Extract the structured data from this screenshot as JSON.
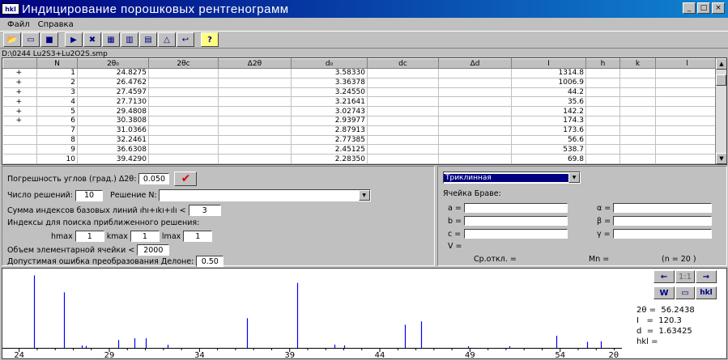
{
  "window": {
    "icon_text": "hkl",
    "title": "Индицирование порошковых рентгенограмм",
    "min": "_",
    "max": "□",
    "close": "×"
  },
  "menu": [
    "Файл",
    "Справка"
  ],
  "toolbar": [
    {
      "icon": "open-folder-icon",
      "glyph": "📂"
    },
    {
      "icon": "save-icon",
      "glyph": "▭"
    },
    {
      "icon": "stop-icon",
      "glyph": "■"
    },
    {
      "icon": "run-icon",
      "glyph": "▶"
    },
    {
      "icon": "delete-icon",
      "glyph": "✖"
    },
    {
      "icon": "table-icon",
      "glyph": "▦"
    },
    {
      "icon": "columns-icon",
      "glyph": "▥"
    },
    {
      "icon": "grid-icon",
      "glyph": "▤"
    },
    {
      "icon": "triangle-icon",
      "glyph": "△"
    },
    {
      "icon": "undo-icon",
      "glyph": "↩"
    },
    {
      "icon": "help-icon",
      "glyph": "?"
    }
  ],
  "file_path": "D:\\0244 Lu2S3+Lu2O2S.smp",
  "table": {
    "headers": [
      "",
      "N",
      "2θ₀",
      "2θc",
      "Δ2θ",
      "d₀",
      "dc",
      "Δd",
      "I",
      "h",
      "k",
      "l"
    ],
    "rows": [
      {
        "mark": "+",
        "n": "1",
        "two_theta": "24.8275",
        "d": "3.58330",
        "i": "1314.8"
      },
      {
        "mark": "+",
        "n": "2",
        "two_theta": "26.4762",
        "d": "3.36378",
        "i": "1006.9"
      },
      {
        "mark": "+",
        "n": "3",
        "two_theta": "27.4597",
        "d": "3.24550",
        "i": "44.2"
      },
      {
        "mark": "+",
        "n": "4",
        "two_theta": "27.7130",
        "d": "3.21641",
        "i": "35.6"
      },
      {
        "mark": "+",
        "n": "5",
        "two_theta": "29.4808",
        "d": "3.02743",
        "i": "142.2"
      },
      {
        "mark": "+",
        "n": "6",
        "two_theta": "30.3808",
        "d": "2.93977",
        "i": "174.3"
      },
      {
        "mark": "",
        "n": "7",
        "two_theta": "31.0366",
        "d": "2.87913",
        "i": "173.6"
      },
      {
        "mark": "",
        "n": "8",
        "two_theta": "32.2461",
        "d": "2.77385",
        "i": "56.6"
      },
      {
        "mark": "",
        "n": "9",
        "two_theta": "36.6308",
        "d": "2.45125",
        "i": "538.7"
      },
      {
        "mark": "",
        "n": "10",
        "two_theta": "39.4290",
        "d": "2.28350",
        "i": "69.8"
      }
    ]
  },
  "params": {
    "angle_error_label": "Погрешность углов (град.)  Δ2θ:",
    "angle_error": "0.050",
    "solutions_label": "Число решений:",
    "solutions": "10",
    "solution_n_label": "Решение N:",
    "sum_label": "Сумма индексов базовых линий  ıhı+ıkı+ılı <",
    "sum_value": "3",
    "indices_label": "Индексы для поиска приближенного решения:",
    "hmax_label": "hmax",
    "hmax": "1",
    "kmax_label": "kmax",
    "kmax": "1",
    "lmax_label": "lmax",
    "lmax": "1",
    "volume_label": "Объем элементарной ячейки <",
    "volume": "2000",
    "delaunay_label": "Допустимая ошибка преобразования Делоне:",
    "delaunay": "0.50"
  },
  "cell": {
    "system": "Триклинная",
    "bravais_label": "Ячейка Браве:",
    "a": "a =",
    "b": "b =",
    "c": "c =",
    "v": "V =",
    "alpha": "α =",
    "beta": "β =",
    "gamma": "γ =",
    "avg_dev": "Ср.откл. =",
    "mn": "Mn =",
    "n_count": "(n =  20 )"
  },
  "chart_side": {
    "prev": "←",
    "page": "1:1",
    "next": "→",
    "btn1": "W",
    "btn2": "▭",
    "btn3": "hkl",
    "two_theta_readout": "2θ =  56.2438",
    "i_readout": "I   =  120.3",
    "d_readout": "d  =  1.63425",
    "hkl_readout": "hkl ="
  },
  "chart_data": {
    "type": "bar",
    "xlim": [
      23.7,
      57.2
    ],
    "ylim": [
      0,
      1350
    ],
    "x_ticks": [
      "24",
      "29",
      "34",
      "39",
      "44",
      "49",
      "54"
    ],
    "x_tick_values": [
      24,
      29,
      34,
      39,
      44,
      49,
      54
    ],
    "xlabel": "2θ",
    "x": [
      24.8275,
      26.4762,
      27.4597,
      27.713,
      29.4808,
      30.3808,
      31.0366,
      32.2461,
      36.6308,
      39.429,
      41.5,
      42.0,
      45.4,
      46.3,
      48.9,
      51.2,
      53.8,
      55.5,
      56.2438
    ],
    "values": [
      1314.8,
      1006.9,
      44.2,
      35.6,
      142.2,
      174.3,
      173.6,
      56.6,
      538.7,
      1180.0,
      60.0,
      45.0,
      420.0,
      480.0,
      30.0,
      30.0,
      220.0,
      110.0,
      120.3
    ]
  },
  "colors": {
    "peak": "#0000ff",
    "accent": "#000080",
    "check": "#e00000"
  }
}
